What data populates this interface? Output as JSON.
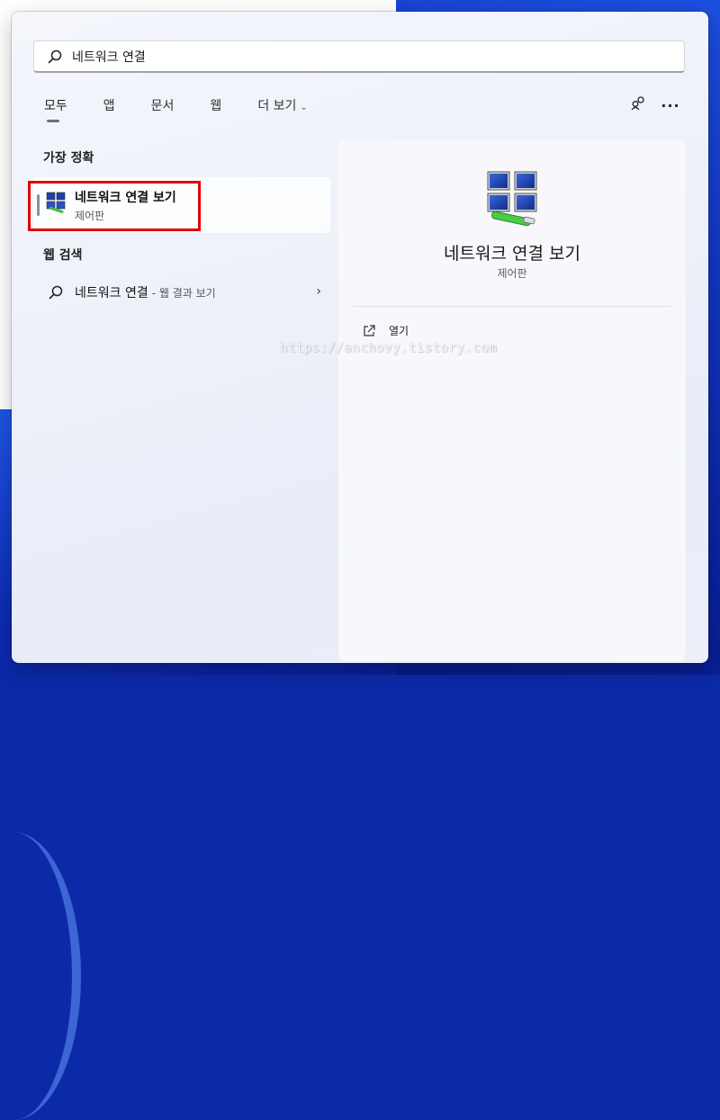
{
  "search": {
    "value": "네트워크 연결",
    "placeholder": ""
  },
  "tabs": [
    {
      "label": "모두"
    },
    {
      "label": "앱"
    },
    {
      "label": "문서"
    },
    {
      "label": "웹"
    },
    {
      "label": "더 보기"
    }
  ],
  "header_actions": {
    "share_icon": "share-icon",
    "more_label": "···"
  },
  "best_match": {
    "title": "가장 정확",
    "item": {
      "name": "네트워크 연결 보기",
      "subtitle": "제어판",
      "icon": "network-connections-icon"
    }
  },
  "web_search": {
    "title": "웹 검색",
    "item": {
      "query": "네트워크 연결",
      "hint": "- 웹 결과 보기"
    }
  },
  "detail": {
    "name": "네트워크 연결 보기",
    "subtitle": "제어판",
    "actions": [
      {
        "label": "열기",
        "icon": "open-icon"
      }
    ]
  },
  "watermark": "https://anchovy.tistory.com",
  "colors": {
    "highlight": "#e00000",
    "panel_bg": "#eef1f9",
    "wallpaper": "#1236c2"
  }
}
